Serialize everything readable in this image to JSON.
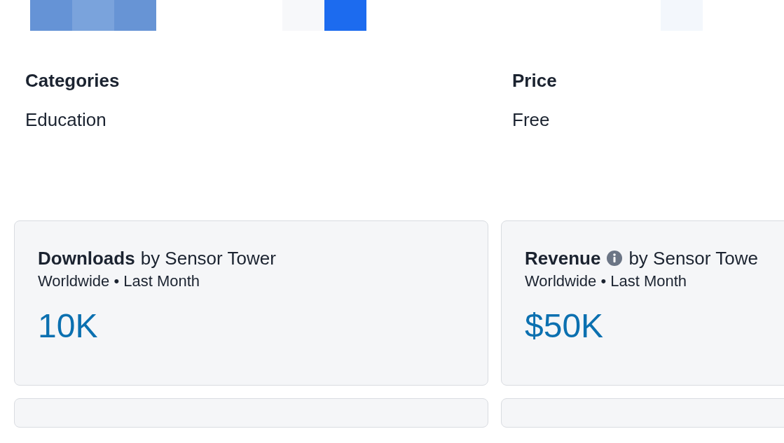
{
  "details": [
    {
      "label": "Categories",
      "value": "Education"
    },
    {
      "label": "Price",
      "value": "Free"
    }
  ],
  "cards": [
    {
      "metric": "Downloads",
      "info": false,
      "source": "by Sensor Tower",
      "scope": "Worldwide • Last Month",
      "value": "10K"
    },
    {
      "metric": "Revenue",
      "info": true,
      "source": "by Sensor Towe",
      "scope": "Worldwide • Last Month",
      "value": "$50K"
    }
  ]
}
